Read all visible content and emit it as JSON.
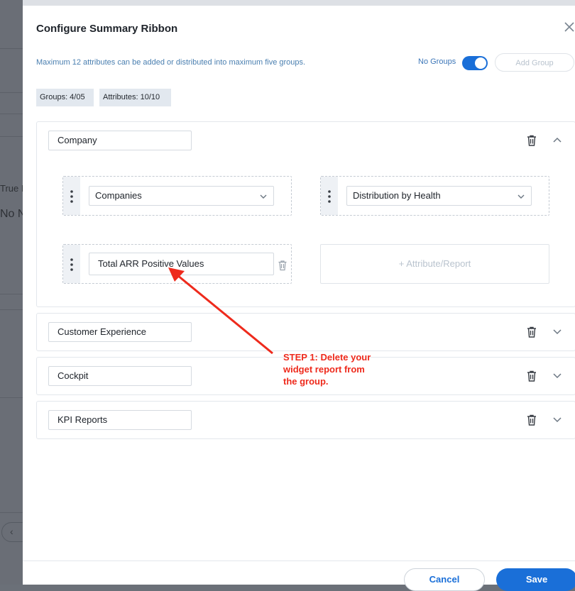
{
  "background": {
    "fragment_1": "True I",
    "fragment_2": "No N"
  },
  "dialog": {
    "title": "Configure Summary Ribbon",
    "info": "Maximum 12 attributes can be added or distributed into maximum five groups.",
    "toggle_label": "No Groups",
    "toggle_on": true,
    "add_group_label": "Add Group",
    "groups_chip": "Groups: 4/05",
    "attributes_chip": "Attributes: 10/10"
  },
  "groups": [
    {
      "name": "Company",
      "expanded": true,
      "slots": [
        {
          "type": "select",
          "value": "Companies"
        },
        {
          "type": "select",
          "value": "Distribution by Health"
        },
        {
          "type": "input",
          "value": "Total ARR Positive Values"
        }
      ],
      "add_attribute_label": "+ Attribute/Report"
    },
    {
      "name": "Customer Experience",
      "expanded": false
    },
    {
      "name": "Cockpit",
      "expanded": false
    },
    {
      "name": "KPI Reports",
      "expanded": false
    }
  ],
  "annotation": {
    "line_1": "STEP 1: Delete your",
    "line_2": "widget report from",
    "line_3": "the group.",
    "color": "#ee2a1c"
  },
  "footer": {
    "cancel_label": "Cancel",
    "save_label": "Save"
  },
  "colors": {
    "accent": "#1a6fd8",
    "info_text": "#4a7fb0",
    "chip_bg": "#e2e8ef"
  }
}
